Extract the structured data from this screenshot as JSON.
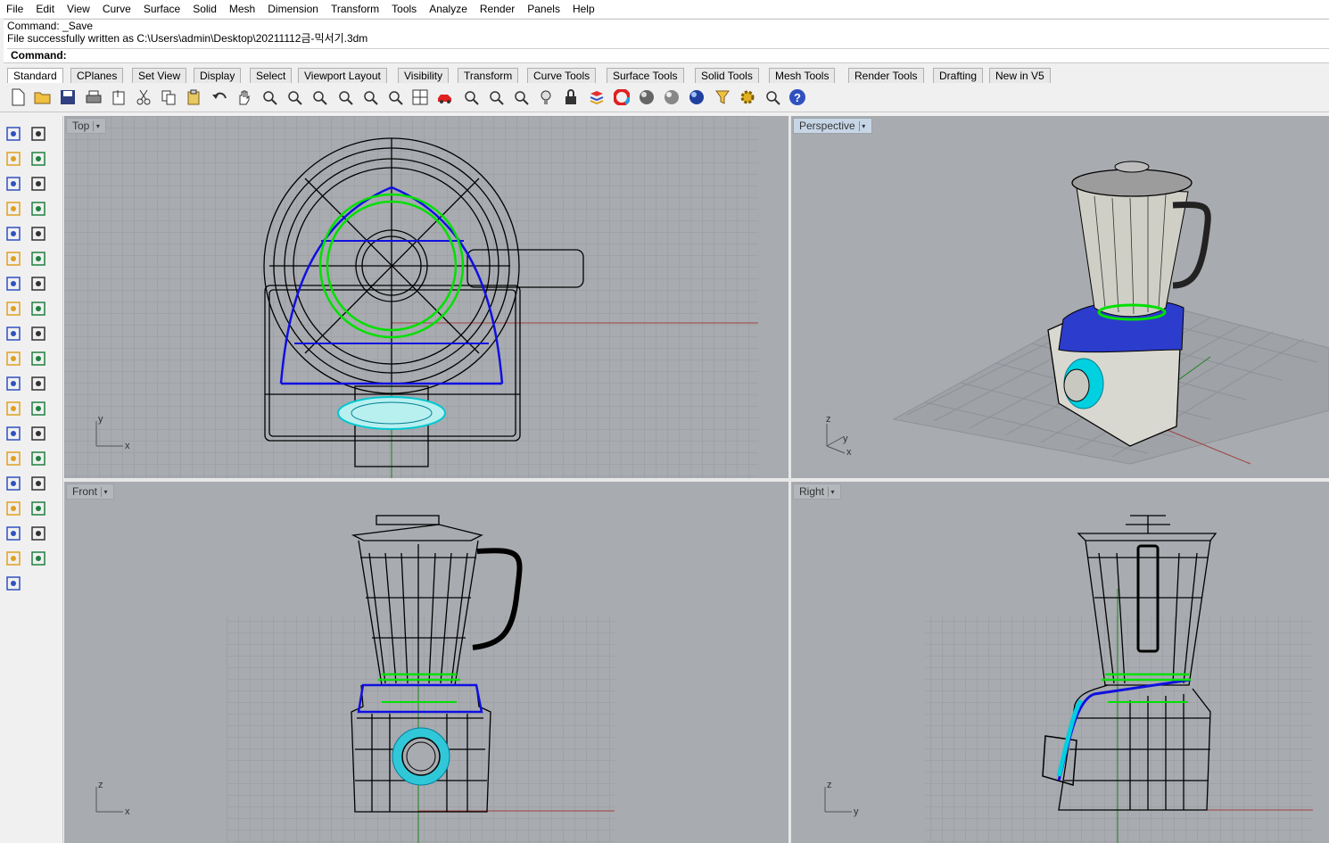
{
  "menu": [
    "File",
    "Edit",
    "View",
    "Curve",
    "Surface",
    "Solid",
    "Mesh",
    "Dimension",
    "Transform",
    "Tools",
    "Analyze",
    "Render",
    "Panels",
    "Help"
  ],
  "command_history": [
    "Command: _Save",
    "File successfully written as C:\\Users\\admin\\Desktop\\20211112금-믹서기.3dm"
  ],
  "command_prompt": "Command:",
  "tabs": [
    "Standard",
    "CPlanes",
    "Set View",
    "Display",
    "Select",
    "Viewport Layout",
    "Visibility",
    "Transform",
    "Curve Tools",
    "Surface Tools",
    "Solid Tools",
    "Mesh Tools",
    "Render Tools",
    "Drafting",
    "New in V5"
  ],
  "active_tab": "Standard",
  "toolbar_icons": [
    "new-icon",
    "open-icon",
    "save-icon",
    "print-icon",
    "import-icon",
    "cut-icon",
    "copy-icon",
    "paste-icon",
    "undo-icon",
    "pan-hand-icon",
    "rotate-view-icon",
    "zoom-icon",
    "zoom-window-icon",
    "zoom-extents-icon",
    "zoom-selected-icon",
    "zoom-dynamic-icon",
    "four-viewports-icon",
    "car-icon",
    "properties-icon",
    "snap-icon",
    "points-icon",
    "light-icon",
    "lock-icon",
    "layer-icon",
    "color-wheel-icon",
    "material-sphere-icon",
    "render-sphere-icon",
    "environment-icon",
    "filter-icon",
    "options-gear-icon",
    "grid-icon",
    "help-icon"
  ],
  "viewports": {
    "top": {
      "label": "Top",
      "axes": [
        "y",
        "x"
      ]
    },
    "perspective": {
      "label": "Perspective",
      "axes": [
        "z",
        "y",
        "x"
      ]
    },
    "front": {
      "label": "Front",
      "axes": [
        "z",
        "x"
      ]
    },
    "right": {
      "label": "Right",
      "axes": [
        "z",
        "y"
      ]
    }
  },
  "colors": {
    "viewport_bg": "#a8abb0",
    "grid": "#979a9f",
    "selected_blue": "#1010e0",
    "green": "#00e000",
    "cyan": "#00e0e0",
    "x_axis": "#a04040",
    "y_axis": "#208020"
  }
}
